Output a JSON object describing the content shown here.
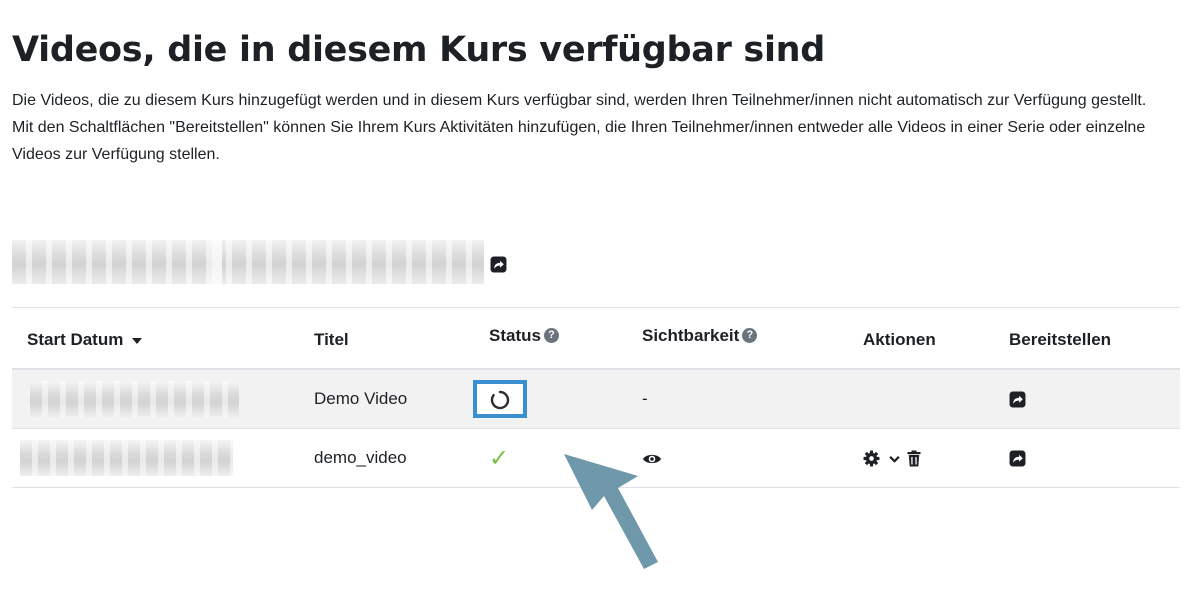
{
  "page": {
    "title": "Videos, die in diesem Kurs verfügbar sind",
    "description_line1": "Die Videos, die zu diesem Kurs hinzugefügt werden und in diesem Kurs verfügbar sind, werden Ihren Teilnehmer/innen nicht automatisch zur Verfügung gestellt.",
    "description_line2": "Mit den Schaltflächen \"Bereitstellen\" können Sie Ihrem Kurs Aktivitäten hinzufügen, die Ihren Teilnehmer/innen entweder alle Videos in einer Serie oder einzelne Videos zur Verfügung stellen."
  },
  "series": {
    "share_icon": "share-square-icon"
  },
  "table": {
    "headers": {
      "start_date": "Start Datum",
      "title": "Titel",
      "status": "Status",
      "visibility": "Sichtbarkeit",
      "actions": "Aktionen",
      "provide": "Bereitstellen"
    },
    "help_glyph": "?",
    "rows": [
      {
        "title": "Demo Video",
        "status_icon": "processing-spinner-icon",
        "visibility": "-",
        "actions": "",
        "provide_icon": "share-square-icon"
      },
      {
        "title": "demo_video",
        "status_icon": "checkmark-icon",
        "status_glyph": "✓",
        "visibility_icon": "eye-icon",
        "actions_icons": [
          "gear-icon",
          "chevron-down-icon",
          "trash-icon"
        ],
        "provide_icon": "share-square-icon"
      }
    ]
  },
  "colors": {
    "highlight_border": "#3a8fd1",
    "success": "#7bc043",
    "annotation_arrow": "#6f98ab",
    "row_alt_bg": "#f2f2f2"
  }
}
